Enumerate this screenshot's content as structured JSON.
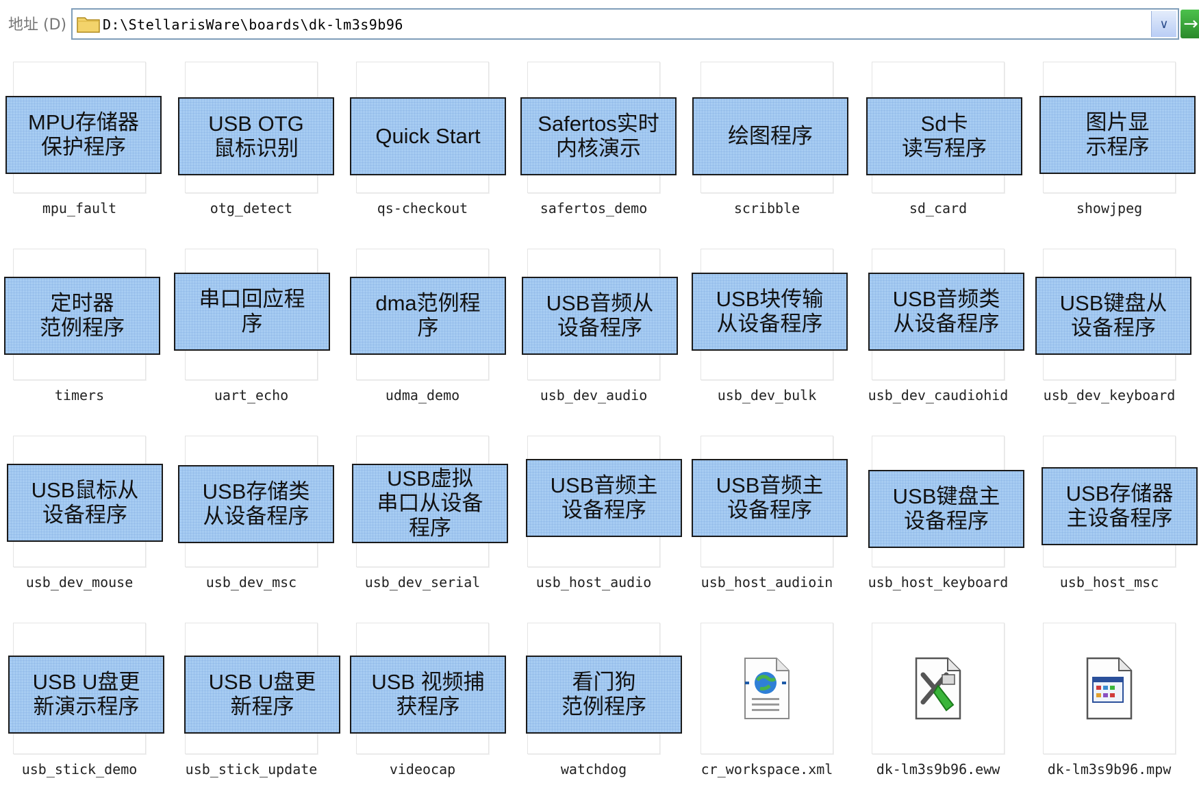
{
  "address_bar": {
    "label": "地址 (D)",
    "path": "D:\\StellarisWare\\boards\\dk-lm3s9b96",
    "dropdown_glyph": "∨",
    "go_glyph": "→"
  },
  "items": [
    {
      "name": "mpu_fault",
      "overlay": "MPU存储器\n保护程序"
    },
    {
      "name": "otg_detect",
      "overlay": "USB OTG\n鼠标识别"
    },
    {
      "name": "qs-checkout",
      "overlay": "Quick Start"
    },
    {
      "name": "safertos_demo",
      "overlay": "Safertos实时\n内核演示"
    },
    {
      "name": "scribble",
      "overlay": "绘图程序"
    },
    {
      "name": "sd_card",
      "overlay": "Sd卡\n读写程序"
    },
    {
      "name": "showjpeg",
      "overlay": "图片显\n示程序"
    },
    {
      "name": "timers",
      "overlay": "定时器\n范例程序"
    },
    {
      "name": "uart_echo",
      "overlay": "串口回应程\n序"
    },
    {
      "name": "udma_demo",
      "overlay": "dma范例程\n序"
    },
    {
      "name": "usb_dev_audio",
      "overlay": "USB音频从\n设备程序"
    },
    {
      "name": "usb_dev_bulk",
      "overlay": "USB块传输\n从设备程序"
    },
    {
      "name": "usb_dev_caudiohid",
      "overlay": "USB音频类\n从设备程序"
    },
    {
      "name": "usb_dev_keyboard",
      "overlay": "USB键盘从\n设备程序"
    },
    {
      "name": "usb_dev_mouse",
      "overlay": "USB鼠标从\n设备程序"
    },
    {
      "name": "usb_dev_msc",
      "overlay": "USB存储类\n从设备程序"
    },
    {
      "name": "usb_dev_serial",
      "overlay": "USB虚拟\n串口从设备\n程序"
    },
    {
      "name": "usb_host_audio",
      "overlay": "USB音频主\n设备程序"
    },
    {
      "name": "usb_host_audioin",
      "overlay": "USB音频主\n设备程序"
    },
    {
      "name": "usb_host_keyboard",
      "overlay": "USB键盘主\n设备程序"
    },
    {
      "name": "usb_host_msc",
      "overlay": "USB存储器\n主设备程序"
    },
    {
      "name": "usb_stick_demo",
      "overlay": "USB U盘更\n新演示程序"
    },
    {
      "name": "usb_stick_update",
      "overlay": "USB U盘更\n新程序"
    },
    {
      "name": "videocap",
      "overlay": "USB 视频捕\n获程序"
    },
    {
      "name": "watchdog",
      "overlay": "看门狗\n范例程序"
    },
    {
      "name": "cr_workspace.xml",
      "overlay": "",
      "icon": "xml-file-icon"
    },
    {
      "name": "dk-lm3s9b96.eww",
      "overlay": "",
      "icon": "eww-file-icon"
    },
    {
      "name": "dk-lm3s9b96.mpw",
      "overlay": "",
      "icon": "mpw-file-icon"
    }
  ],
  "colors": {
    "overlay_fill": "#a7ccf2",
    "overlay_border": "#1a1a1a",
    "address_border": "#7f9db9"
  }
}
